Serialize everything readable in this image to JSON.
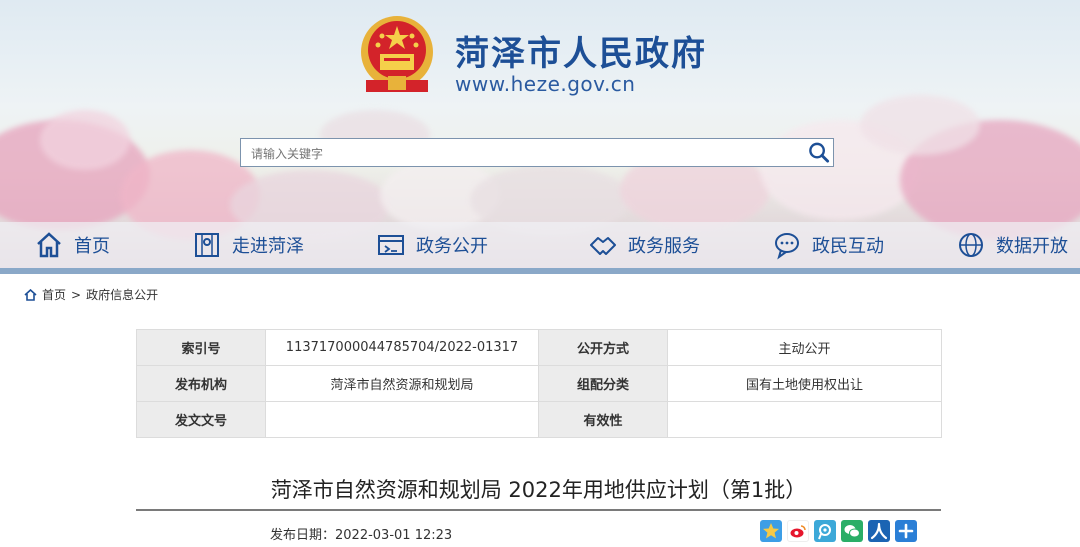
{
  "header": {
    "site_title": "菏泽市人民政府",
    "site_url": "www.heze.gov.cn"
  },
  "search": {
    "placeholder": "请输入关键字"
  },
  "nav": {
    "items": [
      {
        "label": "首页",
        "icon": "home-icon"
      },
      {
        "label": "走进菏泽",
        "icon": "map-icon"
      },
      {
        "label": "政务公开",
        "icon": "window-icon"
      },
      {
        "label": "政务服务",
        "icon": "handshake-icon"
      },
      {
        "label": "政民互动",
        "icon": "chat-icon"
      },
      {
        "label": "数据开放",
        "icon": "globe-icon"
      }
    ]
  },
  "breadcrumb": {
    "home": "首页",
    "separator": ">",
    "section": "政府信息公开"
  },
  "meta_table": {
    "rows": [
      {
        "k1": "索引号",
        "v1": "113717000044785704/2022-01317",
        "k2": "公开方式",
        "v2": "主动公开"
      },
      {
        "k1": "发布机构",
        "v1": "菏泽市自然资源和规划局",
        "k2": "组配分类",
        "v2": "国有土地使用权出让"
      },
      {
        "k1": "发文文号",
        "v1": "",
        "k2": "有效性",
        "v2": ""
      }
    ]
  },
  "article": {
    "title": "菏泽市自然资源和规划局 2022年用地供应计划（第1批）",
    "publish_label": "发布日期：",
    "publish_date": "2022-03-01 12:23"
  },
  "share": {
    "buttons": [
      "qzone-share-icon",
      "weibo-share-icon",
      "tencent-weibo-share-icon",
      "wechat-share-icon",
      "renren-share-icon",
      "more-share-icon"
    ]
  },
  "colors": {
    "brand_blue": "#1d4f96",
    "divider": "#8aa8c8"
  }
}
